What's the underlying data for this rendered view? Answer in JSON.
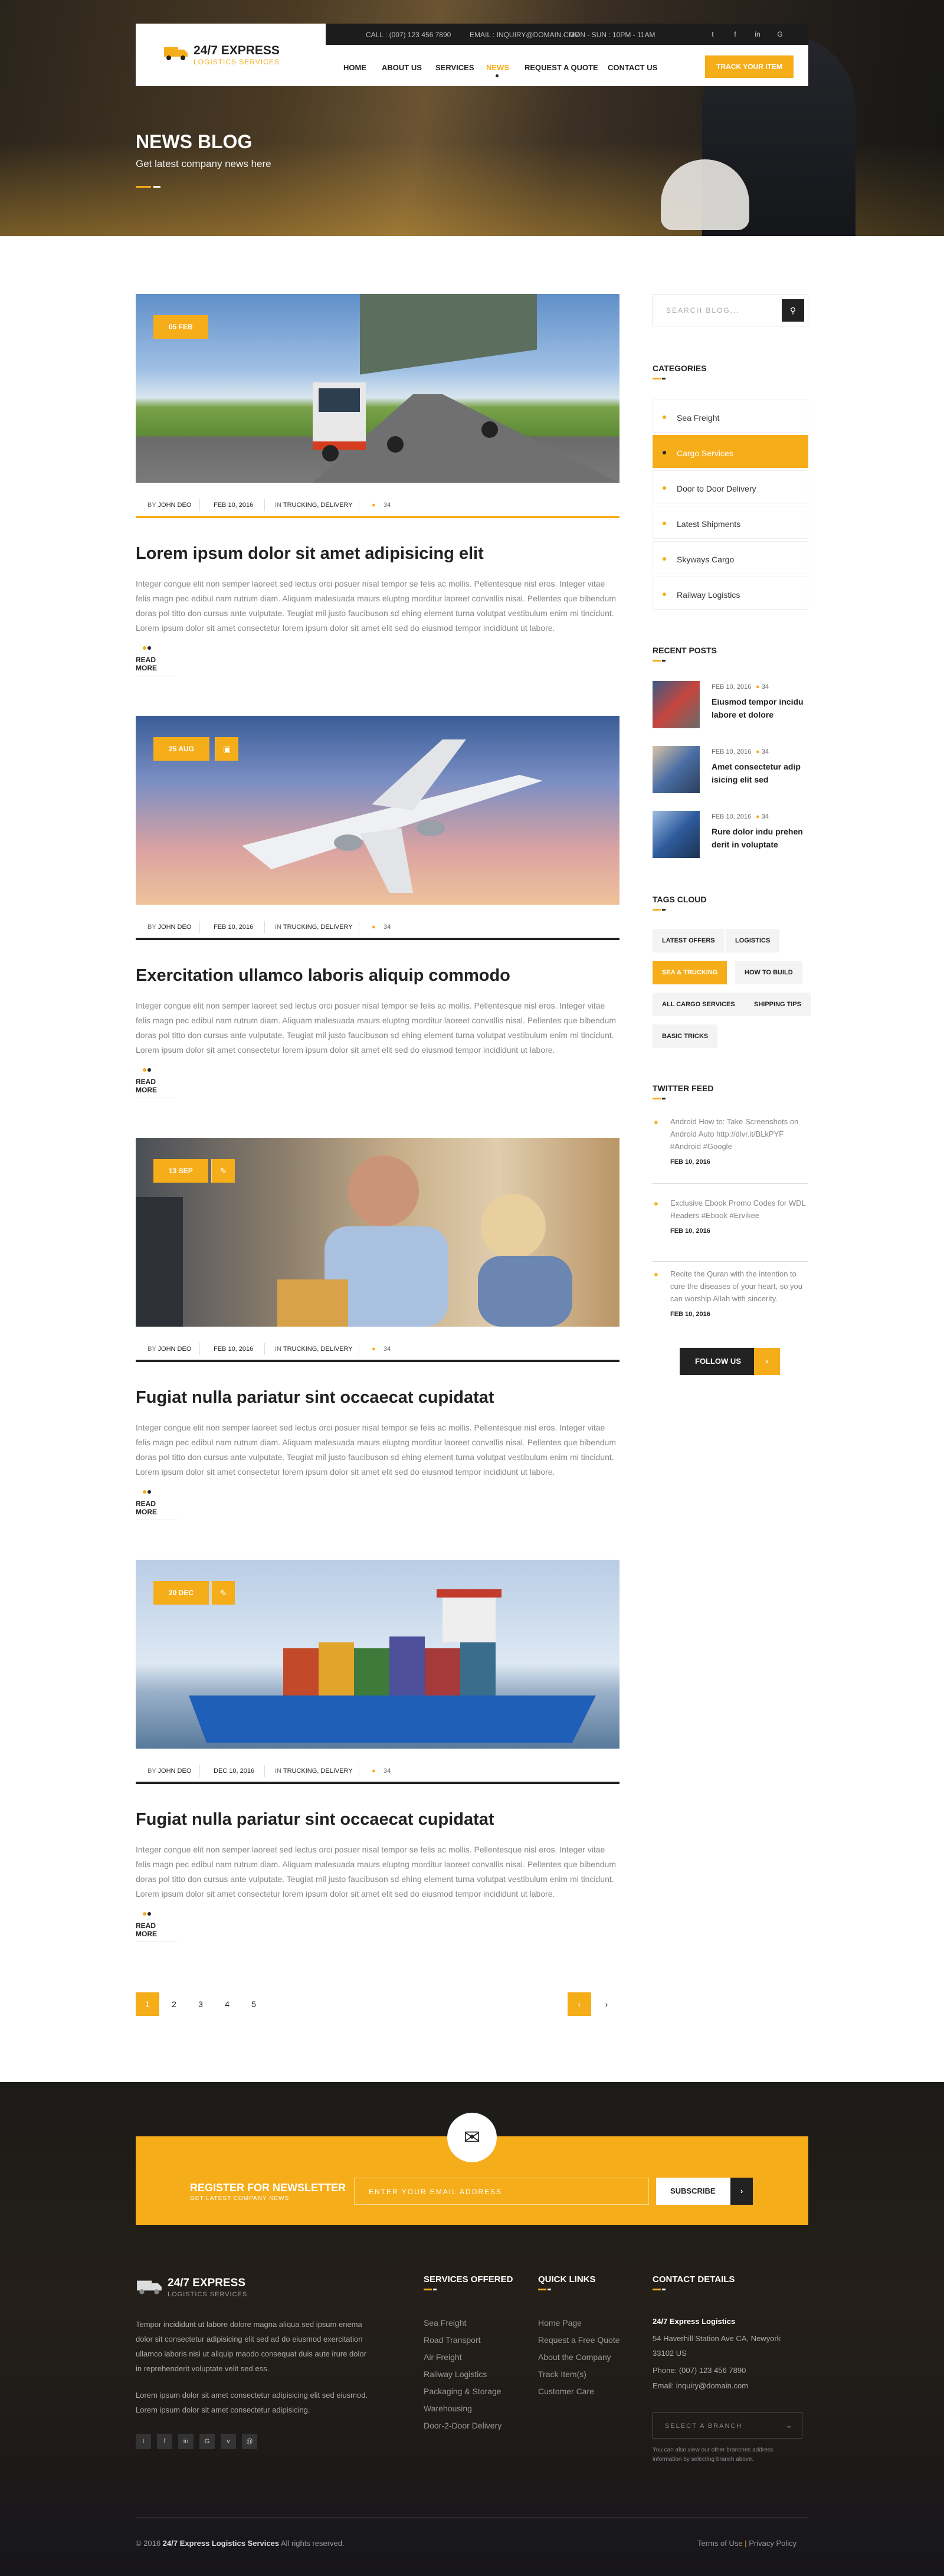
{
  "topbar": {
    "call": "CALL : (007) 123 456 7890",
    "email": "EMAIL : INQUIRY@DOMAIN.COM",
    "hours": "MON - SUN : 10PM - 11AM"
  },
  "logo": {
    "title": "24/7 EXPRESS",
    "subtitle": "LOGISTICS SERVICES"
  },
  "nav": {
    "items": [
      "HOME",
      "ABOUT US",
      "SERVICES",
      "NEWS",
      "REQUEST A QUOTE",
      "CONTACT US"
    ],
    "active": "NEWS",
    "cta": "TRACK YOUR ITEM"
  },
  "hero": {
    "title": "NEWS BLOG",
    "subtitle": "Get latest company news here"
  },
  "posts": [
    {
      "date": "05 FEB",
      "author_prefix": "BY",
      "author": "JOHN DEO",
      "pub": "FEB 10, 2016",
      "in_prefix": "IN",
      "category": "TRUCKING, DELIVERY",
      "comments": "34",
      "title": "Lorem ipsum dolor sit amet adipisicing elit",
      "body": "Integer congue elit non semper laoreet sed lectus orci posuer nisal tempor se felis ac mollis. Pellentesque nisl eros. Integer vitae felis magn pec edibul nam rutrum diam. Aliquam malesuada maurs eluptng morditur laoreet convallis nisal. Pellentes que bibendum doras pol titto don cursus ante vulputate. Teugiat mil justo faucibuson sd ehing element turna volutpat vestibulum enim mi tincidunt. Lorem ipsum dolor sit amet consectetur lorem ipsum dolor sit amet elit sed do eiusmod tempor incididunt ut labore.",
      "more": "READ MORE"
    },
    {
      "date": "25 AUG",
      "author_prefix": "BY",
      "author": "JOHN DEO",
      "pub": "FEB 10, 2016",
      "in_prefix": "IN",
      "category": "TRUCKING, DELIVERY",
      "comments": "34",
      "title": "Exercitation ullamco laboris aliquip commodo",
      "body": "Integer congue elit non semper laoreet sed lectus orci posuer nisal tempor se felis ac mollis. Pellentesque nisl eros. Integer vitae felis magn pec edibul nam rutrum diam. Aliquam malesuada maurs eluptng morditur laoreet convallis nisal. Pellentes que bibendum doras pol titto don cursus ante vulputate. Teugiat mil justo faucibuson sd ehing element turna volutpat vestibulum enim mi tincidunt. Lorem ipsum dolor sit amet consectetur lorem ipsum dolor sit amet elit sed do eiusmod tempor incididunt ut labore.",
      "more": "READ MORE"
    },
    {
      "date": "13 SEP",
      "author_prefix": "BY",
      "author": "JOHN DEO",
      "pub": "FEB 10, 2016",
      "in_prefix": "IN",
      "category": "TRUCKING, DELIVERY",
      "comments": "34",
      "title": "Fugiat nulla pariatur sint occaecat cupidatat",
      "body": "Integer congue elit non semper laoreet sed lectus orci posuer nisal tempor se felis ac mollis. Pellentesque nisl eros. Integer vitae felis magn pec edibul nam rutrum diam. Aliquam malesuada maurs eluptng morditur laoreet convallis nisal. Pellentes que bibendum doras pol titto don cursus ante vulputate. Teugiat mil justo faucibuson sd ehing element turna volutpat vestibulum enim mi tincidunt. Lorem ipsum dolor sit amet consectetur lorem ipsum dolor sit amet elit sed do eiusmod tempor incididunt ut labore.",
      "more": "READ MORE"
    },
    {
      "date": "20 DEC",
      "author_prefix": "BY",
      "author": "JOHN DEO",
      "pub": "DEC 10, 2016",
      "in_prefix": "IN",
      "category": "TRUCKING, DELIVERY",
      "comments": "34",
      "title": "Fugiat nulla pariatur sint occaecat cupidatat",
      "body": "Integer congue elit non semper laoreet sed lectus orci posuer nisal tempor se felis ac mollis. Pellentesque nisl eros. Integer vitae felis magn pec edibul nam rutrum diam. Aliquam malesuada maurs eluptng morditur laoreet convallis nisal. Pellentes que bibendum doras pol titto don cursus ante vulputate. Teugiat mil justo faucibuson sd ehing element turna volutpat vestibulum enim mi tincidunt. Lorem ipsum dolor sit amet consectetur lorem ipsum dolor sit amet elit sed do eiusmod tempor incididunt ut labore.",
      "more": "READ MORE"
    }
  ],
  "pagination": {
    "pages": [
      "1",
      "2",
      "3",
      "4",
      "5"
    ],
    "current": "1",
    "next": "›"
  },
  "sidebar": {
    "search_placeholder": "SEARCH BLOG...",
    "categories_title": "CATEGORIES",
    "categories": [
      "Sea Freight",
      "Cargo Services",
      "Door to Door Delivery",
      "Latest Shipments",
      "Skyways Cargo",
      "Railway Logistics"
    ],
    "active_category": "Cargo Services",
    "recent_title": "RECENT POSTS",
    "recent": [
      {
        "date": "FEB 10, 2016",
        "comments": "34",
        "title": "Eiusmod tempor incidu labore et dolore"
      },
      {
        "date": "FEB 10, 2016",
        "comments": "34",
        "title": "Amet consectetur adip isicing elit sed"
      },
      {
        "date": "FEB 10, 2016",
        "comments": "34",
        "title": "Rure dolor indu prehen derit in voluptate"
      }
    ],
    "tags_title": "TAGS CLOUD",
    "tags": [
      "LATEST OFFERS",
      "LOGISTICS",
      "SEA & TRUCKING",
      "HOW TO BUILD",
      "ALL CARGO SERVICES",
      "SHIPPING TIPS",
      "BASIC TRICKS"
    ],
    "active_tag": "SEA & TRUCKING",
    "twitter_title": "TWITTER FEED",
    "tweets": [
      {
        "text": "Android How to: Take Screenshots on Android Auto http://dlvr.it/BLkPYF #Android #Google",
        "date": "FEB 10, 2016"
      },
      {
        "text": "Exclusive Ebook Promo Codes for WDL Readers #Ebook #Ervikee",
        "date": "FEB 10, 2016"
      },
      {
        "text": "Recite the Quran with the intention to cure the diseases of your heart, so you can worship Allah with sincerity.",
        "date": "FEB 10, 2016"
      }
    ],
    "follow": "FOLLOW US"
  },
  "newsletter": {
    "title": "REGISTER FOR NEWSLETTER",
    "subtitle": "GET LATEST COMPANY NEWS",
    "placeholder": "ENTER YOUR EMAIL ADDRESS",
    "button": "SUBSCRIBE"
  },
  "footer": {
    "logo_title": "24/7 EXPRESS",
    "logo_sub": "LOGISTICS SERVICES",
    "about1": "Tempor incididunt ut labore dolore magna aliqua sed ipsum enema dolor sit consectetur adipisicing elit sed ad do eiusmod exercitation ullamco laboris nisi ut aliquip maodo consequat duis aute irure dolor in reprehenderit voluptate velit sed ess.",
    "about2": "Lorem ipsum dolor sit amet consectetur adipisicing elit sed eiusmod. Lorem ipsum dolor sit amet consectetur adipisicing.",
    "social": [
      "t",
      "f",
      "in",
      "G",
      "v",
      "@"
    ],
    "services_title": "SERVICES OFFERED",
    "services": [
      "Sea Freight",
      "Road Transport",
      "Air Freight",
      "Railway Logistics",
      "Packaging & Storage",
      "Warehousing",
      "Door-2-Door Delivery"
    ],
    "links_title": "QUICK LINKS",
    "links": [
      "Home Page",
      "Request a Free Quote",
      "About the Company",
      "Track Item(s)",
      "Customer Care"
    ],
    "contact_title": "CONTACT DETAILS",
    "company": "24/7 Express Logistics",
    "address": "54 Haverhill Station Ave CA, Newyork 33102 US",
    "phone": "Phone: (007) 123 456 7890",
    "email": "Email: inquiry@domain.com",
    "branch_placeholder": "SELECT A BRANCH",
    "branch_note": "You can also view our other branches address information by selecting branch above.",
    "copyright_year": "© 2016",
    "copyright_company": "24/7 Express Logistics Services",
    "copyright_rest": "All rights reserved.",
    "terms": "Terms of Use",
    "privacy": "Privacy Policy"
  },
  "colors": {
    "accent": "#f6ad1a",
    "dark": "#222222"
  }
}
